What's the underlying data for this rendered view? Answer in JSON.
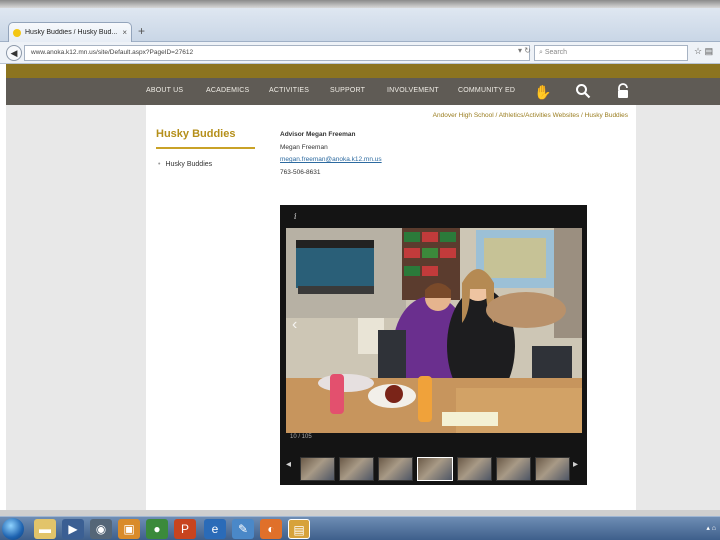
{
  "browser": {
    "tab_title": "Husky Buddies / Husky Bud...",
    "tab_close": "×",
    "new_tab": "+",
    "url": "www.anoka.k12.mn.us/site/Default.aspx?PageID=27612",
    "search_placeholder": "Search",
    "back": "◀"
  },
  "menu": [
    "ABOUT US",
    "ACADEMICS",
    "ACTIVITIES",
    "SUPPORT",
    "INVOLVEMENT",
    "COMMUNITY ED"
  ],
  "breadcrumb": "Andover High School / Athletics/Activities Websites / Husky Buddies",
  "sidebar": {
    "title": "Husky Buddies",
    "items": [
      {
        "label": "Husky Buddies"
      }
    ]
  },
  "advisor": {
    "heading": "Advisor Megan Freeman",
    "name": "Megan Freeman",
    "email": "megan.freeman@anoka.k12.mn.us",
    "phone": "763-506-8631"
  },
  "gallery": {
    "info_icon": "i",
    "counter": "10 / 105",
    "prev": "‹",
    "next": "›",
    "thumb_prev": "◂",
    "thumb_next": "▸",
    "thumbnail_count": 7
  },
  "colors": {
    "gold": "#8c7420",
    "menu_bg": "#5f5b55",
    "accent_text": "#b58f1a"
  }
}
